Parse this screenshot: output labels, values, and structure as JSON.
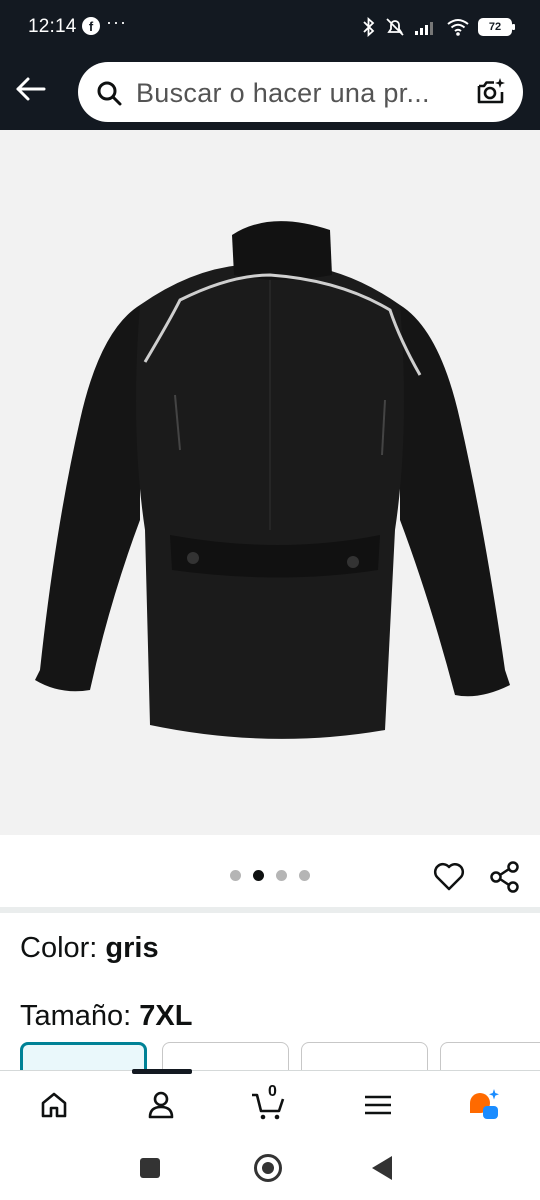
{
  "status_bar": {
    "time": "12:14",
    "more": "···",
    "battery": "72"
  },
  "search": {
    "placeholder": "Buscar o hacer una pr..."
  },
  "product": {
    "image_pager": {
      "total": 4,
      "active_index": 1
    },
    "color_label": "Color: ",
    "color_value": "gris",
    "size_label": "Tamaño: ",
    "size_value": "7XL"
  },
  "bottom_nav": {
    "cart_count": "0",
    "items": [
      "home-icon",
      "account-icon",
      "cart-icon",
      "menu-icon",
      "rufus-icon"
    ]
  },
  "colors": {
    "header_bg": "#131921",
    "accent_teal": "#008296",
    "rufus_orange": "#ff6a00",
    "rufus_blue": "#1a8cff"
  }
}
